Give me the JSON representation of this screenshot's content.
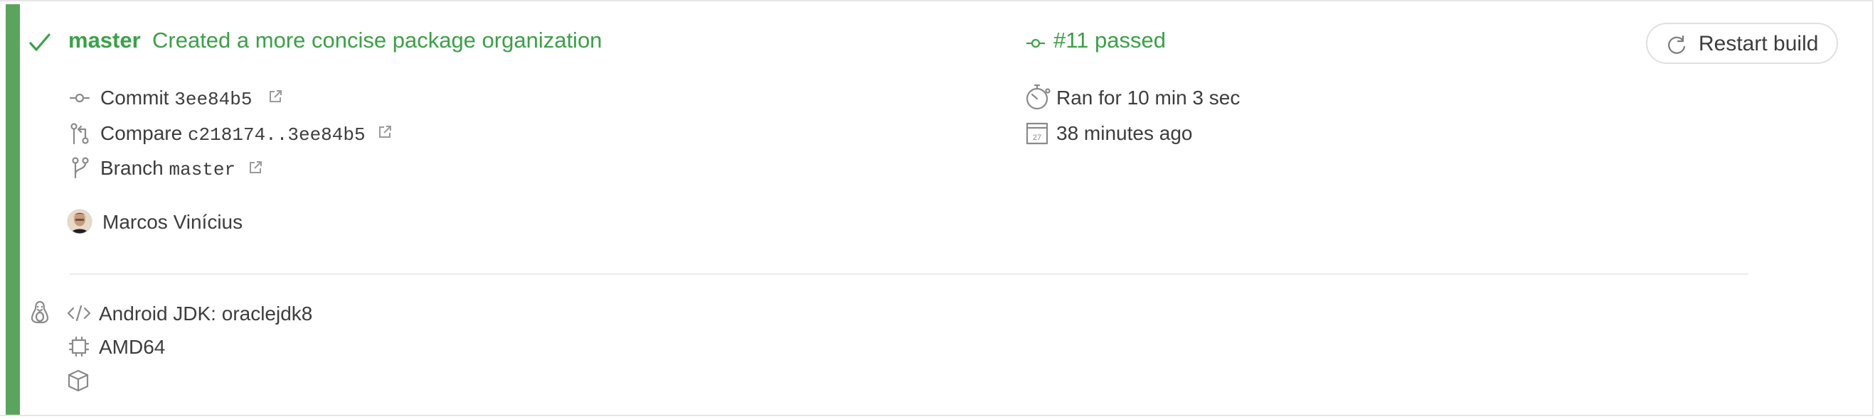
{
  "build": {
    "status_icon": "check-icon",
    "branch": "master",
    "message": "Created a more concise package organization",
    "number_text": "#11 passed",
    "status_color": "#3aa146",
    "stripe_color": "#5aa55e"
  },
  "restart": {
    "label": "Restart build",
    "icon": "restart-icon"
  },
  "details": {
    "commit": {
      "label": "Commit",
      "value": "3ee84b5",
      "icon": "commit-icon"
    },
    "compare": {
      "label": "Compare",
      "value": "c218174..3ee84b5",
      "icon": "compare-icon"
    },
    "branch": {
      "label": "Branch",
      "value": "master",
      "icon": "branch-icon"
    },
    "author": {
      "name": "Marcos Vinícius",
      "icon": "avatar"
    }
  },
  "timing": {
    "duration": "Ran for 10 min 3 sec",
    "duration_icon": "stopwatch-icon",
    "finished": "38 minutes ago",
    "finished_icon": "calendar-icon",
    "calendar_day": "27"
  },
  "config": {
    "os_icon": "linux-icon",
    "language": "Android JDK: oraclejdk8",
    "language_icon": "code-icon",
    "arch": "AMD64",
    "arch_icon": "cpu-icon",
    "env_icon": "box-icon"
  }
}
